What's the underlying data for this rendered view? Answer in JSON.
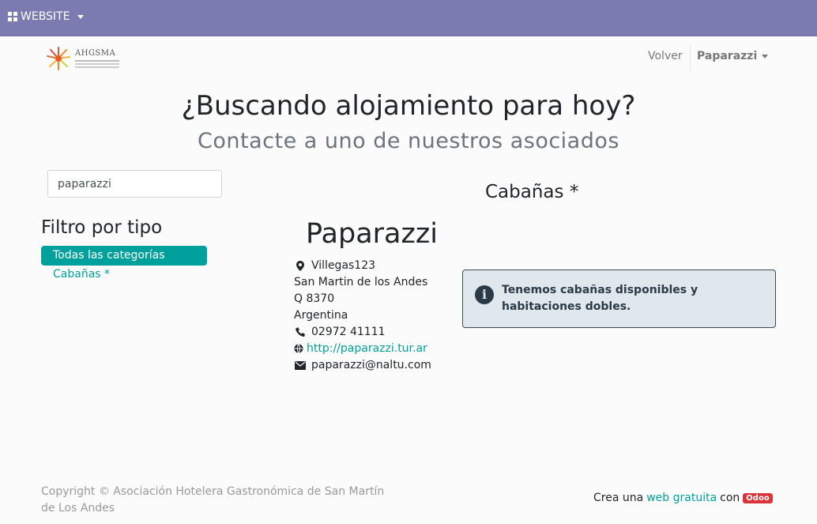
{
  "topbar": {
    "menu_label": "WEBSITE"
  },
  "logo": {
    "text": "AHGSMA"
  },
  "nav": {
    "back_label": "Volver",
    "user_label": "Paparazzi"
  },
  "hero": {
    "title": "¿Buscando alojamiento para hoy?",
    "subtitle": "Contacte a uno de nuestros asociados"
  },
  "search": {
    "value": "paparazzi",
    "placeholder": ""
  },
  "filter": {
    "title": "Filtro por tipo",
    "active": "Todas las categorías",
    "items": [
      "Cabañas *"
    ]
  },
  "business": {
    "name": "Paparazzi",
    "street": "Villegas123",
    "city": "San Martin de los Andes",
    "zip": "Q 8370",
    "country": "Argentina",
    "phone": "02972 41111",
    "website": "http://paparazzi.tur.ar",
    "email": "paparazzi@naltu.com",
    "category": "Cabañas *",
    "note": "Tenemos cabañas disponibles y habitaciones dobles."
  },
  "footer": {
    "copyright": "Copyright © Asociación Hotelera Gastronómica de San Martín de Los Andes",
    "made_prefix": "Crea una",
    "made_link": "web gratuita",
    "made_mid": "con",
    "odoo_badge": "Odoo"
  },
  "colors": {
    "topbar": "#7b7bb1",
    "accent": "#00a09d",
    "alert_bg": "#e0e7ed",
    "odoo": "#d9343c"
  },
  "icons": [
    "grid-icon",
    "map-marker-icon",
    "phone-icon",
    "globe-icon",
    "envelope-icon",
    "info-circle-icon"
  ]
}
